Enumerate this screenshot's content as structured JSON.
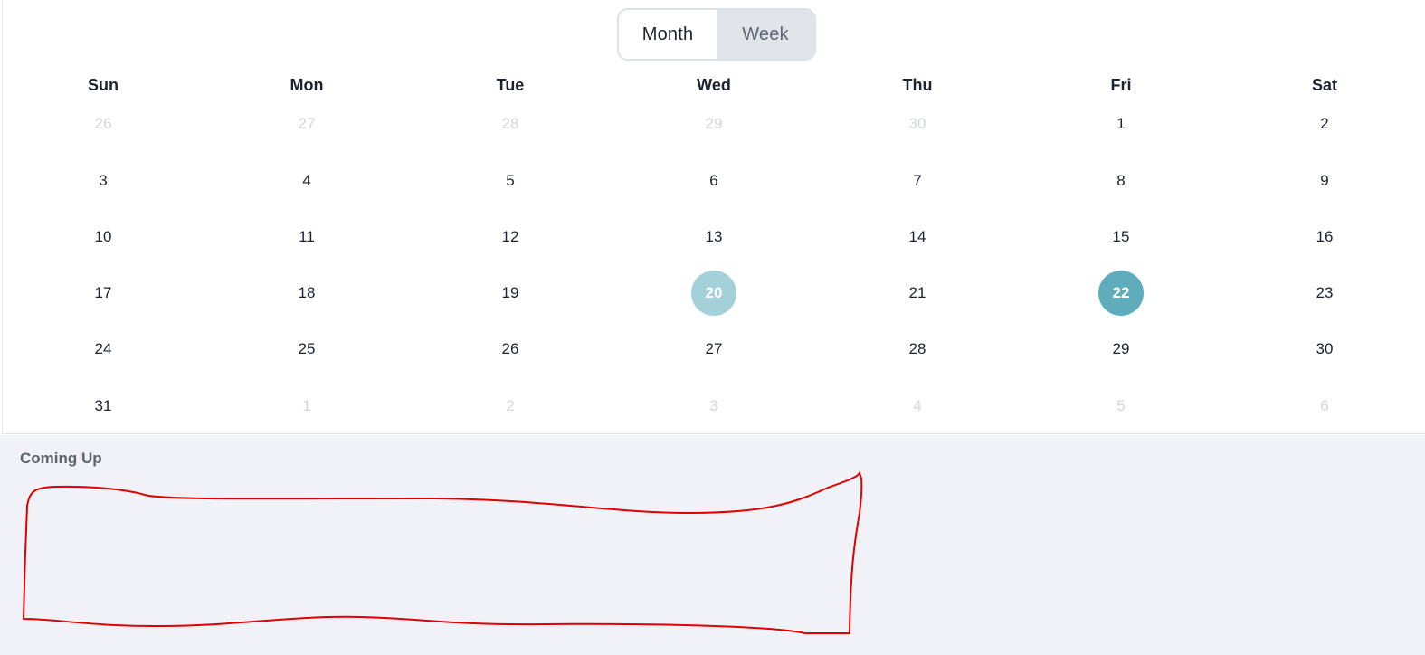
{
  "view_toggle": {
    "month_label": "Month",
    "week_label": "Week",
    "active": "Month"
  },
  "weekdays": [
    "Sun",
    "Mon",
    "Tue",
    "Wed",
    "Thu",
    "Fri",
    "Sat"
  ],
  "weeks": [
    [
      {
        "d": "26",
        "muted": true
      },
      {
        "d": "27",
        "muted": true
      },
      {
        "d": "28",
        "muted": true
      },
      {
        "d": "29",
        "muted": true
      },
      {
        "d": "30",
        "muted": true
      },
      {
        "d": "1"
      },
      {
        "d": "2"
      }
    ],
    [
      {
        "d": "3"
      },
      {
        "d": "4"
      },
      {
        "d": "5"
      },
      {
        "d": "6"
      },
      {
        "d": "7"
      },
      {
        "d": "8"
      },
      {
        "d": "9"
      }
    ],
    [
      {
        "d": "10"
      },
      {
        "d": "11"
      },
      {
        "d": "12"
      },
      {
        "d": "13"
      },
      {
        "d": "14"
      },
      {
        "d": "15"
      },
      {
        "d": "16"
      }
    ],
    [
      {
        "d": "17"
      },
      {
        "d": "18"
      },
      {
        "d": "19"
      },
      {
        "d": "20",
        "state": "range-start"
      },
      {
        "d": "21"
      },
      {
        "d": "22",
        "state": "selected"
      },
      {
        "d": "23"
      }
    ],
    [
      {
        "d": "24"
      },
      {
        "d": "25"
      },
      {
        "d": "26"
      },
      {
        "d": "27"
      },
      {
        "d": "28"
      },
      {
        "d": "29"
      },
      {
        "d": "30"
      }
    ],
    [
      {
        "d": "31"
      },
      {
        "d": "1",
        "muted": true
      },
      {
        "d": "2",
        "muted": true
      },
      {
        "d": "3",
        "muted": true
      },
      {
        "d": "4",
        "muted": true
      },
      {
        "d": "5",
        "muted": true
      },
      {
        "d": "6",
        "muted": true
      }
    ]
  ],
  "coming_up": {
    "title": "Coming Up"
  },
  "colors": {
    "range_start": "#a3d0d9",
    "selected": "#5fadbc",
    "muted_text": "#d3d6db",
    "panel_bg": "#f0f2f7",
    "annotation_stroke": "#e00000"
  }
}
